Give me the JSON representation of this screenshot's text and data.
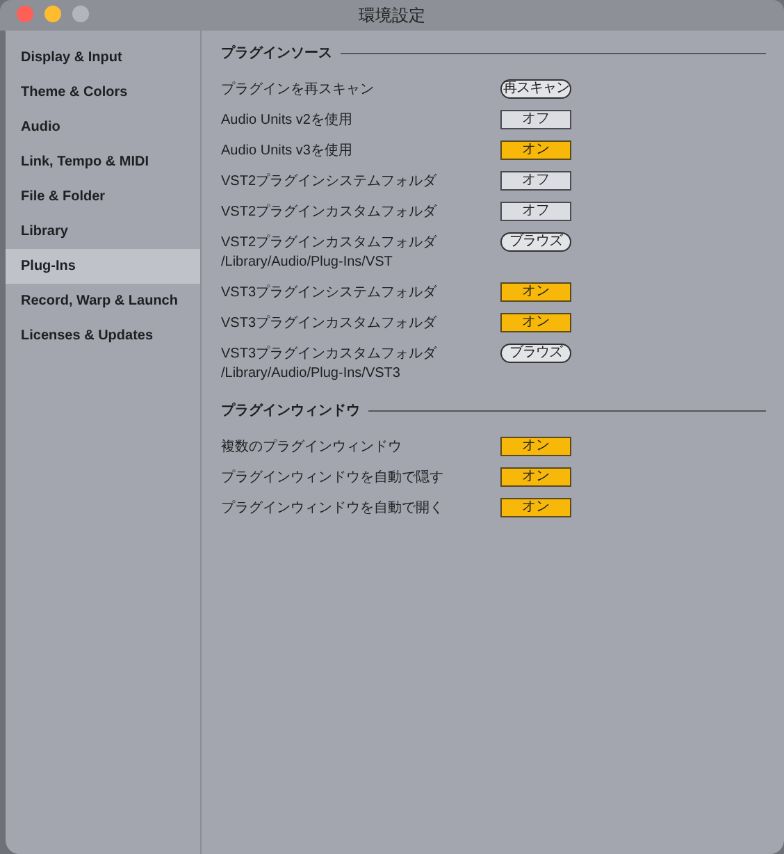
{
  "window": {
    "title": "環境設定"
  },
  "sidebar": {
    "items": [
      {
        "label": "Display & Input",
        "selected": false
      },
      {
        "label": "Theme & Colors",
        "selected": false
      },
      {
        "label": "Audio",
        "selected": false
      },
      {
        "label": "Link, Tempo & MIDI",
        "selected": false
      },
      {
        "label": "File & Folder",
        "selected": false
      },
      {
        "label": "Library",
        "selected": false
      },
      {
        "label": "Plug-Ins",
        "selected": true
      },
      {
        "label": "Record, Warp & Launch",
        "selected": false
      },
      {
        "label": "Licenses & Updates",
        "selected": false
      }
    ]
  },
  "sections": [
    {
      "title": "プラグインソース",
      "rows": [
        {
          "label": "プラグインを再スキャン",
          "kind": "button",
          "button": "再スキャン"
        },
        {
          "label": "Audio Units v2を使用",
          "kind": "toggle",
          "on": false,
          "value": "オフ"
        },
        {
          "label": "Audio Units v3を使用",
          "kind": "toggle",
          "on": true,
          "value": "オン"
        },
        {
          "label": "VST2プラグインシステムフォルダ",
          "kind": "toggle",
          "on": false,
          "value": "オフ"
        },
        {
          "label": "VST2プラグインカスタムフォルダ",
          "kind": "toggle",
          "on": false,
          "value": "オフ"
        },
        {
          "label": "VST2プラグインカスタムフォルダ",
          "kind": "button",
          "button": "ブラウズ",
          "path": "/Library/Audio/Plug-Ins/VST"
        },
        {
          "label": "VST3プラグインシステムフォルダ",
          "kind": "toggle",
          "on": true,
          "value": "オン"
        },
        {
          "label": "VST3プラグインカスタムフォルダ",
          "kind": "toggle",
          "on": true,
          "value": "オン"
        },
        {
          "label": "VST3プラグインカスタムフォルダ",
          "kind": "button",
          "button": "ブラウズ",
          "path": "/Library/Audio/Plug-Ins/VST3"
        }
      ]
    },
    {
      "title": "プラグインウィンドウ",
      "rows": [
        {
          "label": "複数のプラグインウィンドウ",
          "kind": "toggle",
          "on": true,
          "value": "オン"
        },
        {
          "label": "プラグインウィンドウを自動で隠す",
          "kind": "toggle",
          "on": true,
          "value": "オン"
        },
        {
          "label": "プラグインウィンドウを自動で開く",
          "kind": "toggle",
          "on": true,
          "value": "オン"
        }
      ]
    }
  ]
}
